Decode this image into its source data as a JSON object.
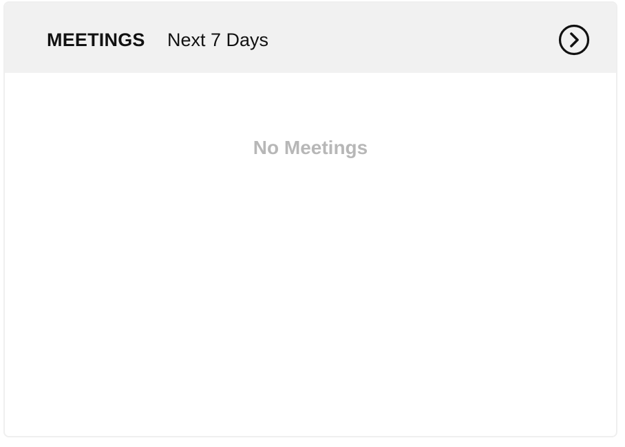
{
  "widget": {
    "title": "MEETINGS",
    "subtitle": "Next 7 Days",
    "next_icon": "chevron-right-circle-icon",
    "empty_message": "No Meetings"
  },
  "colors": {
    "header_background": "#f1f1f1",
    "title_text": "#111111",
    "empty_text": "#b7b7b7",
    "border": "#efefef"
  }
}
